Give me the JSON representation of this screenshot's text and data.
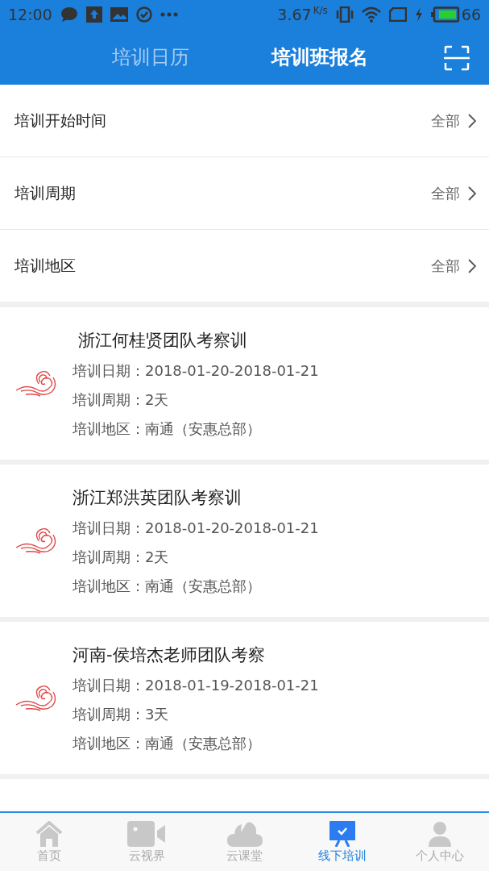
{
  "status_bar": {
    "time": "12:00",
    "speed": "3.67",
    "speed_unit": "K/s",
    "battery_text": "66"
  },
  "header": {
    "tabs": [
      {
        "label": "培训日历",
        "selected": false
      },
      {
        "label": "培训班报名",
        "selected": true
      }
    ]
  },
  "filters": [
    {
      "label": "培训开始时间",
      "value": "全部"
    },
    {
      "label": "培训周期",
      "value": "全部"
    },
    {
      "label": "培训地区",
      "value": "全部"
    }
  ],
  "courses": [
    {
      "title": " 浙江何桂贤团队考察训",
      "lines": [
        "培训日期：2018-01-20-2018-01-21",
        "培训周期：2天",
        "培训地区：南通（安惠总部）"
      ]
    },
    {
      "title": "浙江郑洪英团队考察训",
      "lines": [
        "培训日期：2018-01-20-2018-01-21",
        "培训周期：2天",
        "培训地区：南通（安惠总部）"
      ]
    },
    {
      "title": "河南-侯培杰老师团队考察",
      "lines": [
        "培训日期：2018-01-19-2018-01-21",
        "培训周期：3天",
        "培训地区：南通（安惠总部）"
      ]
    }
  ],
  "bottom_nav": [
    {
      "kind": "home",
      "label": "首页",
      "selected": false
    },
    {
      "kind": "video",
      "label": "云视界",
      "selected": false
    },
    {
      "kind": "cloud",
      "label": "云课堂",
      "selected": false
    },
    {
      "kind": "board",
      "label": "线下培训",
      "selected": true
    },
    {
      "kind": "person",
      "label": "个人中心",
      "selected": false
    }
  ]
}
